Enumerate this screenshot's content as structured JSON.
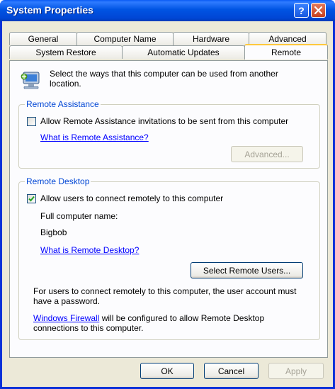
{
  "window": {
    "title": "System Properties",
    "help_glyph": "?",
    "icons": [
      "help-icon",
      "close-icon"
    ]
  },
  "tabs": {
    "row1": [
      "General",
      "Computer Name",
      "Hardware",
      "Advanced"
    ],
    "row2": [
      "System Restore",
      "Automatic Updates",
      "Remote"
    ],
    "active": "Remote"
  },
  "intro": {
    "text_line1": "Select the ways that this computer can be used from another",
    "text_line2": "location.",
    "icon": "remote-computer-icon"
  },
  "remote_assistance": {
    "group_title": "Remote Assistance",
    "checkbox_label": "Allow Remote Assistance invitations to be sent from this computer",
    "checked": false,
    "help_link": "What is Remote Assistance?",
    "advanced_button": "Advanced...",
    "advanced_enabled": false
  },
  "remote_desktop": {
    "group_title": "Remote Desktop",
    "checkbox_label": "Allow users to connect remotely to this computer",
    "checked": true,
    "computer_name_label": "Full computer name:",
    "computer_name": "Bigbob",
    "help_link": "What is Remote Desktop?",
    "select_users_button": "Select Remote Users...",
    "password_note_line1": "For users to connect remotely to this computer, the user account must",
    "password_note_line2": "have a password.",
    "firewall_link": "Windows Firewall",
    "firewall_text_line1": " will be configured to allow Remote Desktop",
    "firewall_text_line2": "connections to this computer."
  },
  "footer": {
    "ok": "OK",
    "cancel": "Cancel",
    "apply": "Apply",
    "apply_enabled": false
  },
  "colors": {
    "title_bar": "#0054e3",
    "group_title": "#0046d5",
    "link": "#0000ff",
    "window_bg": "#ece9d8",
    "active_tab_accent": "#ffc83c"
  }
}
